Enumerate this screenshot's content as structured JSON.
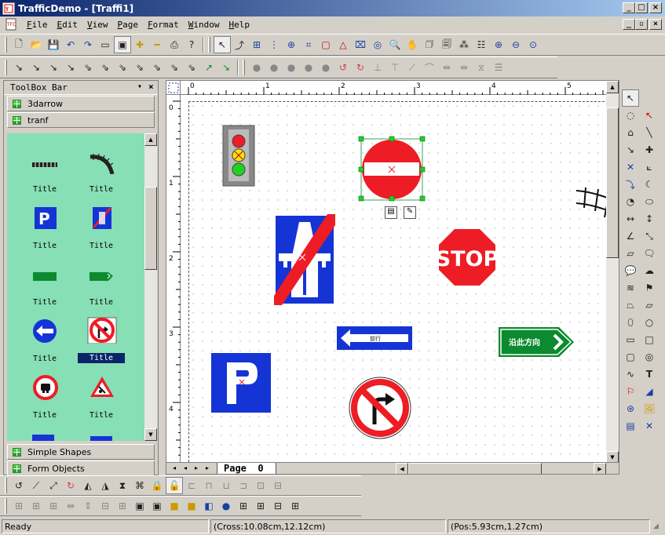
{
  "window": {
    "title": "TrafficDemo - [Traffi1]",
    "app_icon": "tfc-icon"
  },
  "menu": [
    {
      "key": "F",
      "rest": "ile"
    },
    {
      "key": "E",
      "rest": "dit"
    },
    {
      "key": "V",
      "rest": "iew"
    },
    {
      "key": "P",
      "rest": "age"
    },
    {
      "key": "F",
      "rest": "ormat"
    },
    {
      "key": "W",
      "rest": "indow"
    },
    {
      "key": "H",
      "rest": "elp"
    }
  ],
  "toolbox": {
    "title": "ToolBox Bar",
    "categories_top": [
      "3darrow",
      "tranf"
    ],
    "categories_bottom": [
      "Simple Shapes",
      "Form Objects"
    ],
    "items": [
      {
        "label": "Title",
        "icon": "rail-track-icon"
      },
      {
        "label": "Title",
        "icon": "curved-rail-icon"
      },
      {
        "label": "Title",
        "icon": "parking-sign-icon"
      },
      {
        "label": "Title",
        "icon": "no-parking-sign-icon"
      },
      {
        "label": "Title",
        "icon": "green-bar-icon"
      },
      {
        "label": "Title",
        "icon": "green-arrow-icon"
      },
      {
        "label": "Title",
        "icon": "left-arrow-sign-icon"
      },
      {
        "label": "Title",
        "icon": "no-right-turn-sign-icon",
        "selected": true
      },
      {
        "label": "Title",
        "icon": "no-overtaking-sign-icon"
      },
      {
        "label": "Title",
        "icon": "warning-sign-icon"
      }
    ]
  },
  "ruler": {
    "h_labels": [
      "0",
      "1",
      "2",
      "3",
      "4",
      "5"
    ],
    "v_labels": [
      "0",
      "1",
      "2",
      "3",
      "4"
    ]
  },
  "canvas": {
    "stop_text": "STOP",
    "arrow_text": "前行",
    "green_sign_text": "沿此方向"
  },
  "page_tab": {
    "label": "Page  0"
  },
  "status": {
    "left": "Ready",
    "cross": "(Cross:10.08cm,12.12cm)",
    "pos": "(Pos:5.93cm,1.27cm)"
  },
  "colors": {
    "title_start": "#0a246a",
    "title_end": "#a6caf0",
    "palette_bg": "#87dfb5",
    "sign_red": "#ee1c25",
    "sign_blue": "#1534d6",
    "sign_green": "#0b8a2f"
  }
}
